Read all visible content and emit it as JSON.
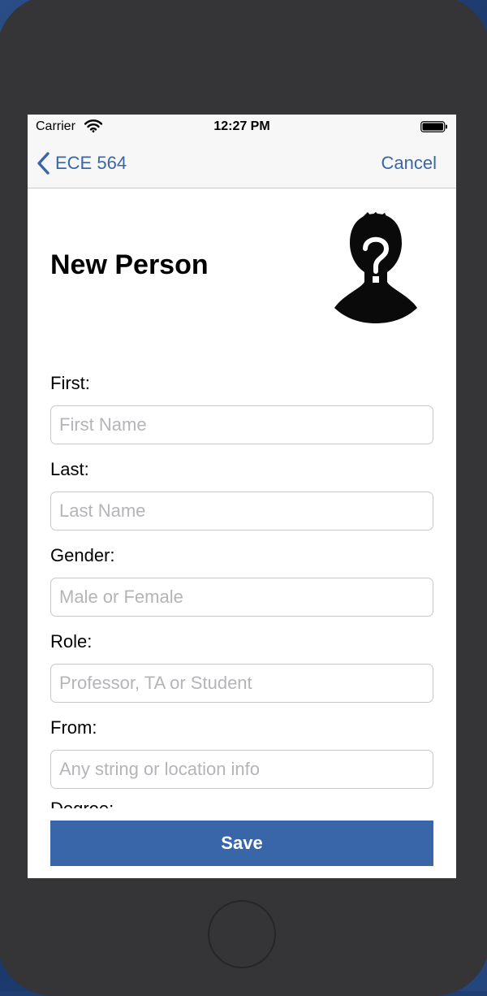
{
  "status_bar": {
    "carrier": "Carrier",
    "time": "12:27 PM"
  },
  "nav": {
    "back_label": "ECE 564",
    "cancel_label": "Cancel"
  },
  "page": {
    "title": "New Person"
  },
  "form": {
    "fields": [
      {
        "label": "First:",
        "placeholder": "First Name",
        "value": ""
      },
      {
        "label": "Last:",
        "placeholder": "Last Name",
        "value": ""
      },
      {
        "label": "Gender:",
        "placeholder": "Male or Female",
        "value": ""
      },
      {
        "label": "Role:",
        "placeholder": "Professor, TA or Student",
        "value": ""
      },
      {
        "label": "From:",
        "placeholder": "Any string or location info",
        "value": ""
      }
    ],
    "partial_label": "Degree:",
    "save_label": "Save"
  },
  "colors": {
    "accent": "#3866a8",
    "device": "#353437"
  },
  "icons": {
    "back": "chevron-left-icon",
    "wifi": "wifi-icon",
    "battery": "battery-icon",
    "avatar": "unknown-person-silhouette"
  }
}
